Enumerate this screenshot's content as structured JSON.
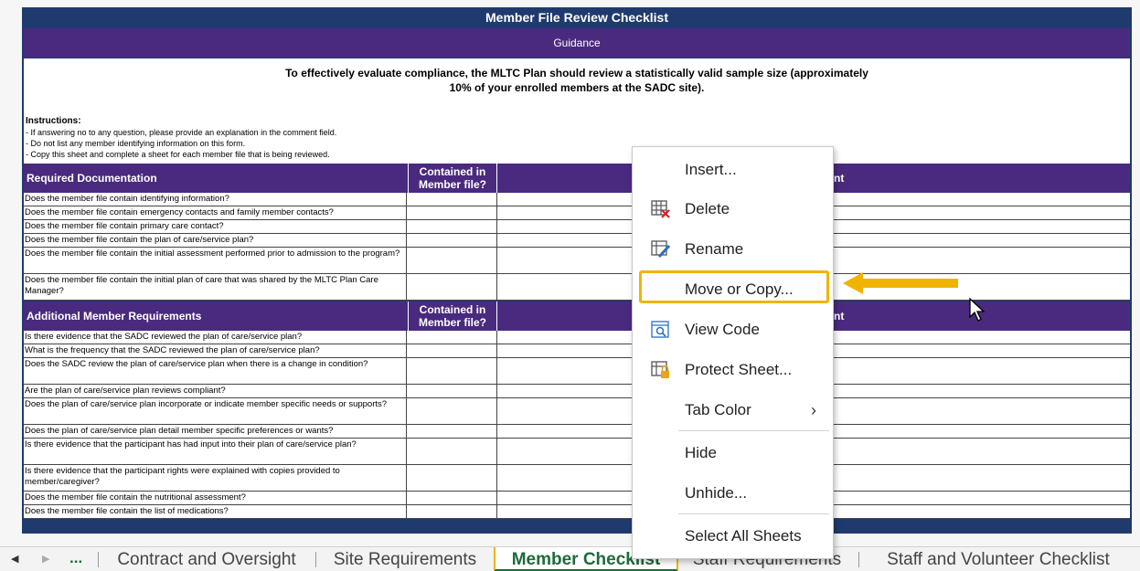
{
  "sheet": {
    "title": "Member File Review Checklist",
    "guidance": "Guidance",
    "intro_line1": "To effectively evaluate compliance, the MLTC Plan should review a statistically valid sample size (approximately",
    "intro_line2": "10% of your enrolled members at the SADC site).",
    "instructions_heading": "Instructions:",
    "instructions": [
      "- If answering no to any question, please provide an explanation in the comment field.",
      "- Do not list any member identifying information on this form.",
      "- Copy this sheet and complete a sheet for each member file that is being reviewed."
    ],
    "sections": [
      {
        "title": "Required Documentation",
        "col_header_line1": "Contained in",
        "col_header_line2": "Member file?",
        "comment_header_fragment": "nt",
        "rows": [
          "Does the member file contain identifying information?",
          "Does the member file contain emergency contacts and family member contacts?",
          "Does the member file contain primary care contact?",
          "Does the member file contain the plan of care/service plan?",
          "Does the member file contain the initial assessment performed prior to admission to the program?",
          "Does the member file contain the initial plan of care that was shared by the MLTC Plan Care Manager?"
        ]
      },
      {
        "title": "Additional Member Requirements",
        "col_header_line1": "Contained in",
        "col_header_line2": "Member file?",
        "comment_header_fragment": "nt",
        "rows": [
          "Is there evidence that the SADC reviewed the plan of care/service plan?",
          "What is the frequency that the SADC reviewed the plan of care/service plan?",
          "Does the SADC review the plan of care/service plan when there is a change in condition?",
          "Are the plan of care/service plan reviews compliant?",
          "Does the plan of care/service plan incorporate or indicate member specific needs or supports?",
          "Does the plan of care/service plan detail member specific preferences or wants?",
          "Is there evidence that the participant has had input into their plan of care/service plan?",
          "Is there evidence that the participant rights were explained with copies provided to member/caregiver?",
          "Does the member file contain the nutritional assessment?",
          "Does the member file contain the list of medications?"
        ]
      }
    ]
  },
  "context_menu": {
    "items": [
      {
        "label": "Insert...",
        "icon": "none"
      },
      {
        "label": "Delete",
        "icon": "delete-sheet-icon"
      },
      {
        "label": "Rename",
        "icon": "rename-sheet-icon"
      },
      {
        "label": "Move or Copy...",
        "icon": "none",
        "highlighted": true
      },
      {
        "label": "View Code",
        "icon": "view-code-icon"
      },
      {
        "label": "Protect Sheet...",
        "icon": "protect-sheet-icon"
      },
      {
        "label": "Tab Color",
        "icon": "none",
        "submenu": true
      },
      {
        "label": "Hide",
        "icon": "none"
      },
      {
        "label": "Unhide...",
        "icon": "none"
      },
      {
        "label": "Select All Sheets",
        "icon": "none"
      }
    ]
  },
  "tabs": {
    "more": "...",
    "items": [
      {
        "label": "Contract and Oversight",
        "active": false
      },
      {
        "label": "Site Requirements",
        "active": false
      },
      {
        "label": "Member Checklist",
        "active": true
      },
      {
        "label": "Staff Requirements",
        "active": false
      },
      {
        "label": "Staff and Volunteer Checklist",
        "active": false
      }
    ]
  },
  "colors": {
    "sheet_border": "#1f3a6e",
    "header_purple": "#4a2a7f",
    "highlight": "#f0b400",
    "active_tab": "#1e6b3a"
  }
}
